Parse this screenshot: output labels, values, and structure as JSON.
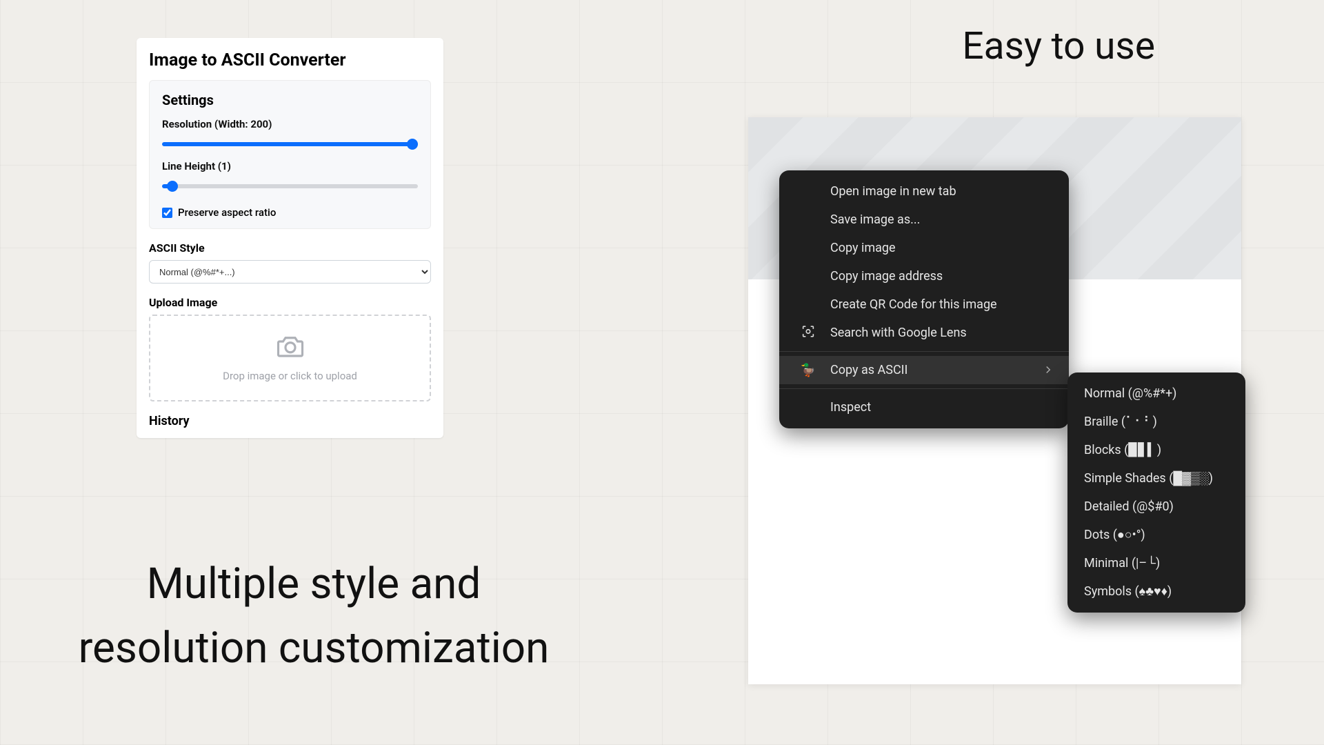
{
  "converter": {
    "title": "Image to ASCII Converter",
    "settings_heading": "Settings",
    "resolution_label": "Resolution (Width: 200)",
    "lineheight_label": "Line Height (1)",
    "preserve_aspect_label": "Preserve aspect ratio",
    "ascii_style_label": "ASCII Style",
    "ascii_style_value": "Normal (@%#*+...)",
    "upload_label": "Upload Image",
    "drop_text": "Drop image or click to upload",
    "history_label": "History"
  },
  "captions": {
    "left_line1": "Multiple style and",
    "left_line2": "resolution customization",
    "right": "Easy to use"
  },
  "ctx": {
    "open_new_tab": "Open image in new tab",
    "save_as": "Save image as...",
    "copy_image": "Copy image",
    "copy_address": "Copy image address",
    "qr_code": "Create QR Code for this image",
    "google_lens": "Search with Google Lens",
    "copy_ascii": "Copy as ASCII",
    "inspect": "Inspect"
  },
  "submenu": {
    "normal": "Normal (@%#*+)",
    "braille": "Braille (⠁⠂⠃)",
    "blocks": "Blocks (▉▋▍)",
    "shades": "Simple Shades (█▓▒░)",
    "detailed": "Detailed (@$#0)",
    "dots": "Dots (●○•°)",
    "minimal": "Minimal (|–└)",
    "symbols": "Symbols (♠♣♥♦)"
  }
}
